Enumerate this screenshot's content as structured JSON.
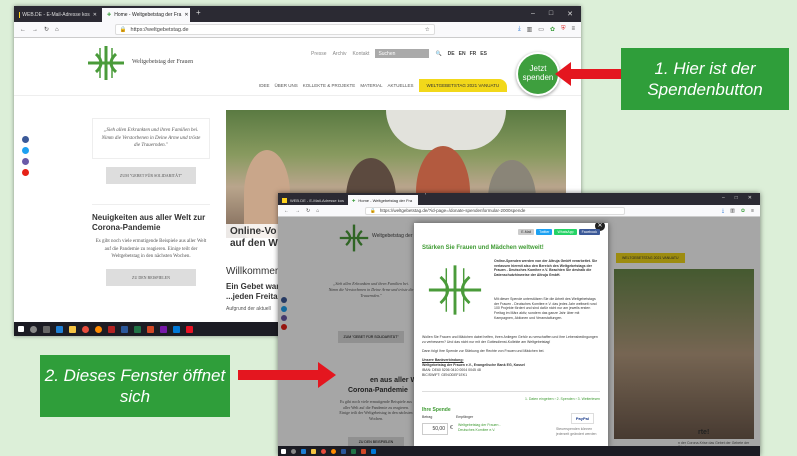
{
  "browser1": {
    "tabs": [
      {
        "label": "WEB.DE - E-Mail-Adresse kos"
      },
      {
        "label": "Home - Weltgebetstag der Fra"
      }
    ],
    "url": "https://weltgebetstag.de",
    "brand": "Weltgebetstag der Frauen",
    "toplinks": [
      "Presse",
      "Archiv",
      "Kontakt"
    ],
    "search_placeholder": "Suchen",
    "langs": [
      "DE",
      "EN",
      "FR",
      "ES"
    ],
    "nav": [
      "IDEE",
      "ÜBER UNS",
      "KOLLEKTE & PROJEKTE",
      "MATERIAL",
      "AKTUELLES"
    ],
    "nav_highlight": "WELTGEBETSTAG 2021 VANUATU",
    "donate_label": "Jetzt spenden",
    "quote": "„Sieh allen Erkrankten und ihren Familien bei. Nimm die Verstorbenen in Deine Arme und tröste die Trauernden.\"",
    "quote_button": "ZUM \"GEBET FÜR SOLIDARITÄT\"",
    "news_title": "Neuigkeiten aus aller Welt zur Corona-Pandemie",
    "news_text": "Es gibt noch viele ermutigende Beispiele aus aller Welt auf die Pandemie zu reagieren. Einige teilt der Weltgebetstag in den nächsten Wochen.",
    "news_button": "ZU DEN BEISPIELEN",
    "overlay_title_1": "Online-Vo",
    "overlay_title_2": "auf den W",
    "welcome": "Willkommen",
    "gebet_line1": "Ein Gebet wande",
    "gebet_line2": "...jeden Freitag",
    "aufgrund": "Aufgrund der aktuell"
  },
  "callouts": {
    "c1": "1. Hier ist der Spendenbutton",
    "c2": "2. Dieses Fenster öffnet sich"
  },
  "browser2": {
    "tabs": [
      {
        "label": "WEB.DE - E-Mail-Adresse kos"
      },
      {
        "label": "Home - Weltgebetstag der Fra"
      }
    ],
    "url": "https://weltgebetstag.de/?id-page=/donate-spendenformular-2000spende",
    "brand": "Weltgebetstag der Frauen",
    "modal": {
      "share": [
        "E-Mail",
        "Twitter",
        "WhatsApp",
        "Facebook"
      ],
      "title": "Stärken Sie Frauen und Mädchen weltweit!",
      "p1": "Online-Spenden werden von der Altruja GmbH verarbeitet. Sie verlassen hiermit also den Bereich des Weltgebetstags der Frauen - Deutsches Komitee e.V. Beachten Sie deshalb die Datenschutzhinweise der Altruja GmbH.",
      "p2": "Mit dieser Spende unterstützen Sie die Arbeit des Weltgebetstags der Frauen - Deutsches Komitee e.V. das jedes Jahr weltweit rund 100 Projekte fördert und sind dafür nicht nur am jeweils ersten Freitag im März aktiv, sondern das ganze Jahr über mit Kampagnen, Aktionen und Veranstaltungen.",
      "p3": "Wollen Sie Frauen und Mädchen dabei helfen, ihren Anliegen Gehör zu verschaffen und ihre Lebensbedingungen zu verbessern? Und das nicht nur mit der Gottesdienst-Kollekte am Weltgebetstag!",
      "p4": "Dann folgt Ihre Spende zur Stärkung der Rechte von Frauen und Mädchen bei.",
      "bank_title": "Unsere Bankverbindung:",
      "bank_name": "Weltgebetstag der Frauen e.V., Evangelische Bank EG, Kassel",
      "iban": "IBAN: DE60 5206 0410 0004 0045 48",
      "bic": "BIC/SWIFT: GENODEF1EK1",
      "steps": "1. Daten eingeben  ›  2. Spenden  ›  3. Weiterlesen",
      "ihre_spende": "Ihre Spende",
      "betrag_label": "Betrag",
      "empf_label": "Empfänger",
      "amount": "50,00",
      "currency": "€",
      "recipient": "Weltgebetstag der Frauen - Deutsches Komitee e.V.",
      "paypal": "PayPal",
      "paypal_note": "Steuerspenden können jederzeit geändert werden"
    },
    "side_quote": "„Sieh allen Erkrankten und ihren Familien bei. Nimm die Verstorbenen in Deine Arme und tröste die Trauernden.\"",
    "side_button": "ZUM \"GEBET FÜR SOLIDARITÄT\"",
    "side_news_1": "en aus aller Welt",
    "side_news_2": "Corona-Pandemie",
    "side_text": "Es gibt noch viele ermutigende Beispiele aus aller Welt auf die Pandemie zu reagieren. Einige teilt der Weltgebetstag in den nächsten Wochen.",
    "side_button2": "ZU DEN BEISPIELEN",
    "nav_highlight": "WELTGEBETSTAG 2021 VANUATU",
    "photo_caption_1": "rte!",
    "photo_caption_2": "n der Corona-Krise das Gebet der Gebete der Woche."
  },
  "colors": {
    "accent_green": "#2f9e3a",
    "arrow_red": "#e4161f",
    "nav_yellow": "#f2d81a"
  }
}
